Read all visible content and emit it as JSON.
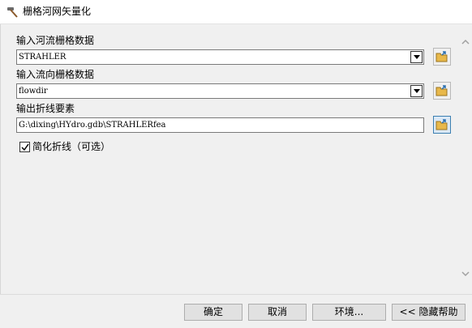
{
  "window": {
    "title": "栅格河网矢量化",
    "icon": "hammer-icon"
  },
  "fields": {
    "input_stream_raster": {
      "label": "输入河流栅格数据",
      "value": "STRAHLER"
    },
    "input_flow_direction": {
      "label": "输入流向栅格数据",
      "value": "flowdir"
    },
    "output_polyline": {
      "label": "输出折线要素",
      "value": "G:\\dixing\\HYdro.gdb\\STRAHLERfea"
    }
  },
  "simplify": {
    "label": "简化折线（可选）",
    "checked": true
  },
  "footer": {
    "ok_label": "确定",
    "cancel_label": "取消",
    "env_label": "环境...",
    "help_label": "<< 隐藏帮助"
  },
  "colors": {
    "background": "#f0f0f0",
    "field_border": "#7a7a7a",
    "folder_yellow": "#e8b84a",
    "active_button_border": "#3c7fb1"
  }
}
